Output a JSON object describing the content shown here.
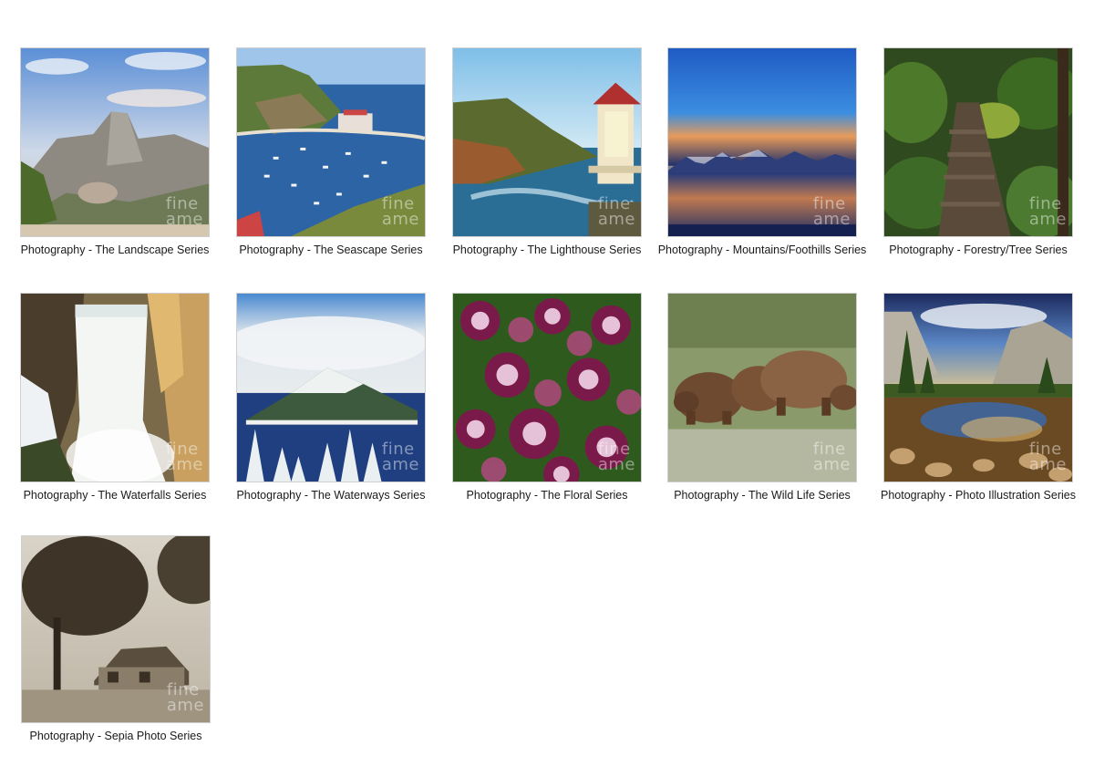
{
  "watermark": [
    "fine",
    "ame"
  ],
  "tiles": [
    {
      "caption": "Photography - The Landscape Series"
    },
    {
      "caption": "Photography - The Seascape Series"
    },
    {
      "caption": "Photography - The Lighthouse Series"
    },
    {
      "caption": "Photography - Mountains/Foothills Series"
    },
    {
      "caption": "Photography - Forestry/Tree Series"
    },
    {
      "caption": "Photography - The Waterfalls Series"
    },
    {
      "caption": "Photography - The Waterways Series"
    },
    {
      "caption": "Photography - The Floral Series"
    },
    {
      "caption": "Photography - The Wild Life Series"
    },
    {
      "caption": "Photography - Photo Illustration Series"
    },
    {
      "caption": "Photography - Sepia Photo Series"
    }
  ]
}
